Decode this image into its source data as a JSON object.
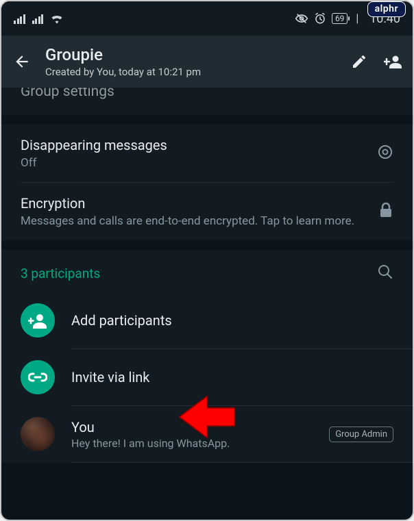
{
  "watermark": "alphr",
  "status": {
    "battery_pct": "69",
    "time": "10:40"
  },
  "header": {
    "title": "Groupie",
    "subtitle": "Created by You, today at 10:21 pm"
  },
  "sections": {
    "group_settings_label": "Group settings",
    "disappearing": {
      "title": "Disappearing messages",
      "value": "Off"
    },
    "encryption": {
      "title": "Encryption",
      "desc": "Messages and calls are end-to-end encrypted. Tap to learn more."
    }
  },
  "participants": {
    "count_label": "3 participants",
    "add_label": "Add participants",
    "invite_label": "Invite via link",
    "you": {
      "name": "You",
      "status": "Hey there! I am using WhatsApp.",
      "badge": "Group Admin"
    }
  }
}
